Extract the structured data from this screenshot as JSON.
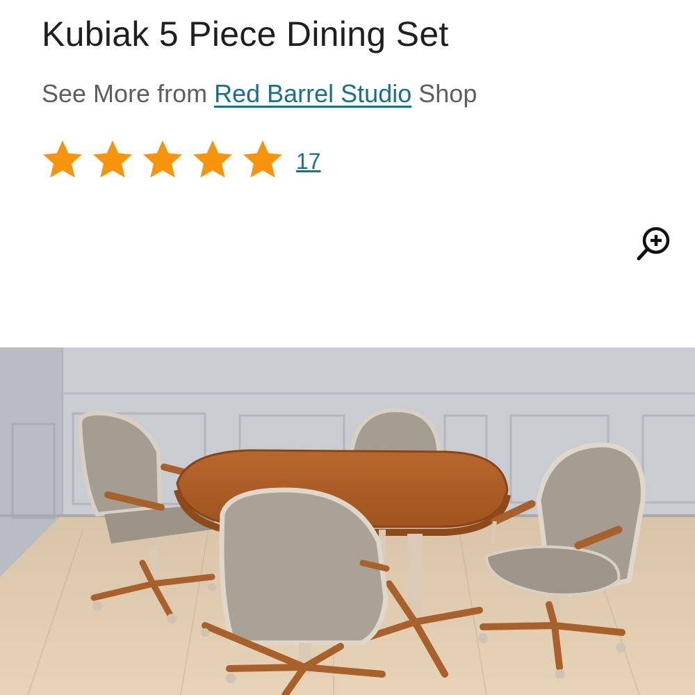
{
  "product": {
    "title": "Kubiak 5 Piece Dining Set",
    "seller_prefix": "See More from",
    "seller_link": "Red Barrel Studio",
    "seller_suffix": "Shop",
    "rating": {
      "stars": 5,
      "max_stars": 5,
      "review_count": "17",
      "star_color": "#f7940c"
    }
  },
  "icons": {
    "zoom": "zoom-in-icon",
    "star": "star-icon"
  },
  "colors": {
    "link": "#1a6f8c",
    "text": "#1f1f1f",
    "subtext": "#5e5e5e"
  }
}
